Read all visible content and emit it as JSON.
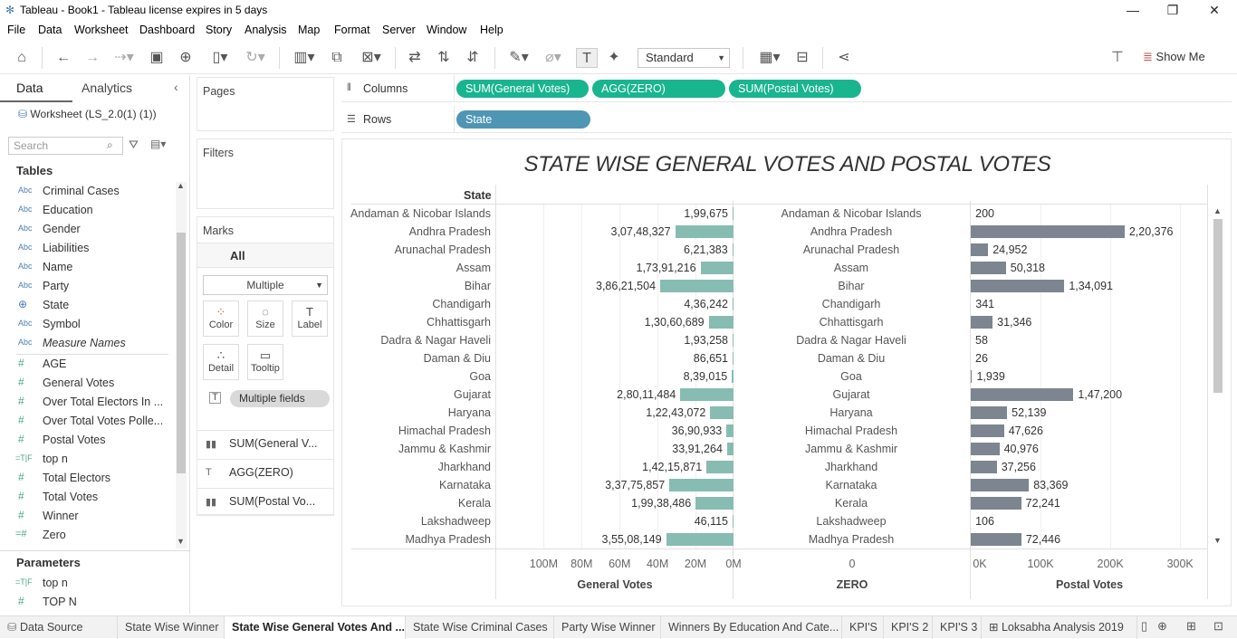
{
  "window": {
    "title": "Tableau - Book1 - Tableau license expires in 5 days"
  },
  "menu": [
    "File",
    "Data",
    "Worksheet",
    "Dashboard",
    "Story",
    "Analysis",
    "Map",
    "Format",
    "Server",
    "Window",
    "Help"
  ],
  "toolbar": {
    "fit_mode": "Standard",
    "show_me": "Show Me"
  },
  "data_pane": {
    "tabs": [
      "Data",
      "Analytics"
    ],
    "datasource": "Worksheet (LS_2.0(1) (1))",
    "search_placeholder": "Search",
    "tables_header": "Tables",
    "dimensions": [
      {
        "type": "Abc",
        "name": "Criminal Cases"
      },
      {
        "type": "Abc",
        "name": "Education"
      },
      {
        "type": "Abc",
        "name": "Gender"
      },
      {
        "type": "Abc",
        "name": "Liabilities"
      },
      {
        "type": "Abc",
        "name": "Name"
      },
      {
        "type": "Abc",
        "name": "Party"
      },
      {
        "type": "globe",
        "name": "State"
      },
      {
        "type": "Abc",
        "name": "Symbol"
      },
      {
        "type": "Abc",
        "name": "Measure Names"
      }
    ],
    "measures": [
      {
        "type": "#",
        "name": "AGE"
      },
      {
        "type": "#",
        "name": "General Votes"
      },
      {
        "type": "#",
        "name": "Over Total Electors  In ..."
      },
      {
        "type": "#",
        "name": "Over Total Votes Polle..."
      },
      {
        "type": "#",
        "name": "Postal Votes"
      },
      {
        "type": "=T|F",
        "name": "top n"
      },
      {
        "type": "#",
        "name": "Total Electors"
      },
      {
        "type": "#",
        "name": "Total Votes"
      },
      {
        "type": "#",
        "name": "Winner"
      },
      {
        "type": "=#",
        "name": "Zero"
      }
    ],
    "parameters_header": "Parameters",
    "parameters": [
      {
        "type": "=T|F",
        "name": "top n"
      },
      {
        "type": "#",
        "name": "TOP N"
      }
    ]
  },
  "cards": {
    "pages": "Pages",
    "filters": "Filters",
    "marks": "Marks",
    "marks_all": "All",
    "mark_type": "Multiple",
    "mark_buttons": [
      "Color",
      "Size",
      "Label",
      "Detail",
      "Tooltip"
    ],
    "label_pill": "Multiple fields",
    "measure_tabs": [
      "SUM(General V...",
      "AGG(ZERO)",
      "SUM(Postal Vo..."
    ]
  },
  "shelves": {
    "columns_label": "Columns",
    "rows_label": "Rows",
    "columns": [
      "SUM(General Votes)",
      "AGG(ZERO)",
      "SUM(Postal Votes)"
    ],
    "rows": [
      "State"
    ]
  },
  "chart_data": {
    "type": "bar",
    "title": "STATE WISE GENERAL VOTES AND POSTAL VOTES",
    "row_header": "State",
    "categories": [
      "Andaman & Nicobar Islands",
      "Andhra Pradesh",
      "Arunachal Pradesh",
      "Assam",
      "Bihar",
      "Chandigarh",
      "Chhattisgarh",
      "Dadra & Nagar Haveli",
      "Daman & Diu",
      "Goa",
      "Gujarat",
      "Haryana",
      "Himachal Pradesh",
      "Jammu & Kashmir",
      "Jharkhand",
      "Karnataka",
      "Kerala",
      "Lakshadweep",
      "Madhya Pradesh"
    ],
    "series": [
      {
        "name": "General Votes",
        "values": [
          199675,
          30748327,
          621383,
          17391216,
          38621504,
          436242,
          13060689,
          193258,
          86651,
          839015,
          28011484,
          12243072,
          3690933,
          3391264,
          14215871,
          33775857,
          19938486,
          46115,
          35508149
        ],
        "labels": [
          "1,99,675",
          "3,07,48,327",
          "6,21,383",
          "1,73,91,216",
          "3,86,21,504",
          "4,36,242",
          "1,30,60,689",
          "1,93,258",
          "86,651",
          "8,39,015",
          "2,80,11,484",
          "1,22,43,072",
          "36,90,933",
          "33,91,264",
          "1,42,15,871",
          "3,37,75,857",
          "1,99,38,486",
          "46,115",
          "3,55,08,149"
        ],
        "axis_ticks": [
          "100M",
          "80M",
          "60M",
          "40M",
          "20M",
          "0M"
        ],
        "range": [
          0,
          125000000
        ],
        "reversed": true
      },
      {
        "name": "ZERO",
        "values": [
          0,
          0,
          0,
          0,
          0,
          0,
          0,
          0,
          0,
          0,
          0,
          0,
          0,
          0,
          0,
          0,
          0,
          0,
          0
        ],
        "axis_ticks": [
          "0"
        ]
      },
      {
        "name": "Postal Votes",
        "values": [
          200,
          220376,
          24952,
          50318,
          134091,
          341,
          31346,
          58,
          26,
          1939,
          147200,
          52139,
          47626,
          40976,
          37256,
          83369,
          72241,
          106,
          72446
        ],
        "labels": [
          "200",
          "2,20,376",
          "24,952",
          "50,318",
          "1,34,091",
          "341",
          "31,346",
          "58",
          "26",
          "1,939",
          "1,47,200",
          "52,139",
          "47,626",
          "40,976",
          "37,256",
          "83,369",
          "72,241",
          "106",
          "72,446"
        ],
        "axis_ticks": [
          "0K",
          "100K",
          "200K",
          "300K"
        ],
        "range": [
          0,
          340000
        ]
      }
    ],
    "colors": {
      "general": "#87bcb3",
      "postal": "#7d8590"
    }
  },
  "sheet_tabs": [
    "Data Source",
    "State Wise Winner",
    "State Wise General Votes And ...",
    "State Wise Criminal Cases",
    "Party Wise Winner",
    "Winners By Education And Cate...",
    "KPI'S",
    "KPI'S 2",
    "KPI'S 3",
    "Loksabha Analysis 2019"
  ]
}
